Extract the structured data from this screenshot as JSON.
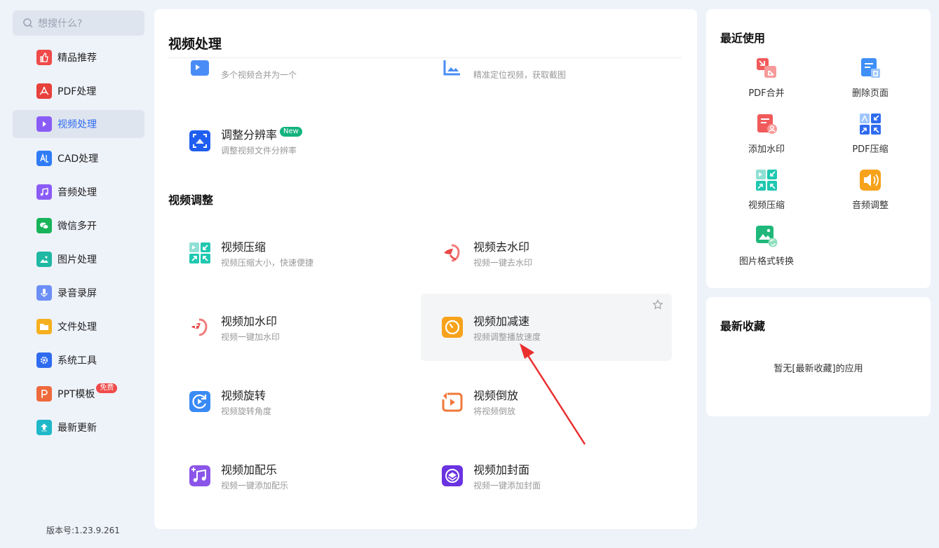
{
  "search": {
    "placeholder": "想搜什么?"
  },
  "sidebar": {
    "items": [
      {
        "label": "精品推荐",
        "icon": "thumbs-up-icon",
        "color": "#ef4a4a"
      },
      {
        "label": "PDF处理",
        "icon": "pdf-icon",
        "color": "#e8403b"
      },
      {
        "label": "视频处理",
        "icon": "video-play-icon",
        "color": "#8a5cf6",
        "active": true
      },
      {
        "label": "CAD处理",
        "icon": "cad-icon",
        "color": "#2f7cf6"
      },
      {
        "label": "音频处理",
        "icon": "music-icon",
        "color": "#8a5cf6"
      },
      {
        "label": "微信多开",
        "icon": "wechat-icon",
        "color": "#18b45a"
      },
      {
        "label": "图片处理",
        "icon": "image-icon",
        "color": "#1fb8a2"
      },
      {
        "label": "录音录屏",
        "icon": "microphone-icon",
        "color": "#6c8ff6"
      },
      {
        "label": "文件处理",
        "icon": "folder-icon",
        "color": "#f6b01f"
      },
      {
        "label": "系统工具",
        "icon": "gear-icon",
        "color": "#2f6bf0"
      },
      {
        "label": "PPT模板",
        "icon": "ppt-icon",
        "color": "#ee6a3c",
        "badge": "免费"
      },
      {
        "label": "最新更新",
        "icon": "upload-icon",
        "color": "#1fb8c8"
      }
    ],
    "version": "版本号:1.23.9.261"
  },
  "main": {
    "title": "视频处理",
    "partial_tools": [
      {
        "desc": "多个视频合并为一个",
        "icon": "video-merge-icon"
      },
      {
        "desc": "精准定位视频，获取截图",
        "icon": "video-screenshot-icon"
      }
    ],
    "resolution_tool": {
      "name": "调整分辨率",
      "desc": "调整视频文件分辨率",
      "badge": "New",
      "icon": "resolution-icon"
    },
    "section2_title": "视频调整",
    "tools": [
      {
        "name": "视频压缩",
        "desc": "视频压缩大小，快速便捷",
        "icon": "compress-icon"
      },
      {
        "name": "视频去水印",
        "desc": "视频一键去水印",
        "icon": "remove-watermark-icon"
      },
      {
        "name": "视频加水印",
        "desc": "视频一键加水印",
        "icon": "add-watermark-icon"
      },
      {
        "name": "视频加减速",
        "desc": "视频调整播放速度",
        "icon": "speed-icon"
      },
      {
        "name": "视频旋转",
        "desc": "视频旋转角度",
        "icon": "rotate-icon"
      },
      {
        "name": "视频倒放",
        "desc": "将视频倒放",
        "icon": "reverse-icon"
      },
      {
        "name": "视频加配乐",
        "desc": "视频一键添加配乐",
        "icon": "add-music-icon"
      },
      {
        "name": "视频加封面",
        "desc": "视频一键添加封面",
        "icon": "add-cover-icon"
      }
    ]
  },
  "recent": {
    "title": "最近使用",
    "items": [
      {
        "label": "PDF合并",
        "icon": "pdf-merge-icon"
      },
      {
        "label": "删除页面",
        "icon": "delete-page-icon"
      },
      {
        "label": "添加水印",
        "icon": "add-watermark-icon"
      },
      {
        "label": "PDF压缩",
        "icon": "pdf-compress-icon"
      },
      {
        "label": "视频压缩",
        "icon": "video-compress-icon"
      },
      {
        "label": "音频调整",
        "icon": "audio-adjust-icon"
      },
      {
        "label": "图片格式转换",
        "icon": "image-convert-icon"
      }
    ]
  },
  "favorites": {
    "title": "最新收藏",
    "empty_text": "暂无[最新收藏]的应用"
  }
}
